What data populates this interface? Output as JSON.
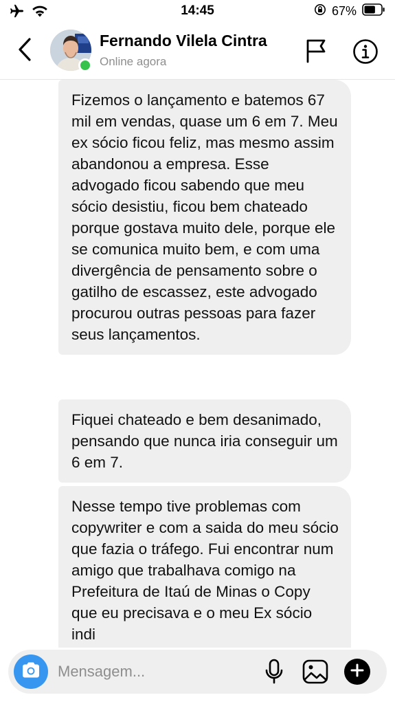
{
  "status_bar": {
    "time": "14:45",
    "battery_percent": "67%",
    "battery_level": 0.67,
    "icons": [
      "airplane-mode-icon",
      "wifi-icon",
      "orientation-lock-icon",
      "battery-icon"
    ]
  },
  "header": {
    "contact_name": "Fernando Vilela Cintra",
    "status": "Online agora",
    "online_color": "#37c24d",
    "icons": [
      "back-chevron-icon",
      "flag-icon",
      "info-icon"
    ]
  },
  "messages": [
    {
      "text": "Fizemos o lançamento e batemos 67 mil em vendas, quase um 6 em 7. Meu ex sócio ficou feliz, mas mesmo assim abandonou a empresa. Esse advogado ficou sabendo que meu sócio desistiu, ficou bem chateado porque gostava muito dele, porque ele se comunica muito bem, e com uma divergência de pensamento sobre o gatilho de escassez, este advogado procurou outras pessoas para fazer seus lançamentos."
    },
    {
      "text": "Fiquei chateado e bem desanimado, pensando que nunca iria conseguir um 6 em 7."
    },
    {
      "text": "Nesse tempo tive problemas com copywriter e com a saida do meu sócio que fazia o tráfego. Fui encontrar num amigo que trabalhava comigo na Prefeitura de Itaú de Minas o Copy que eu precisava e o meu Ex sócio indi"
    }
  ],
  "composer": {
    "placeholder": "Mensagem...",
    "accent_color": "#3797f0",
    "icons": [
      "camera-icon",
      "microphone-icon",
      "gallery-icon",
      "plus-icon"
    ]
  }
}
